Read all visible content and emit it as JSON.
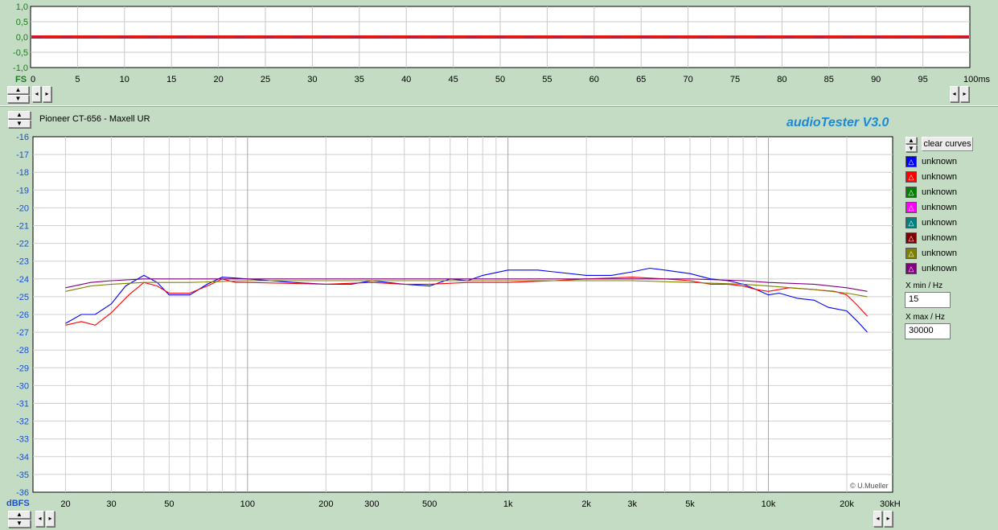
{
  "colors": {
    "background": "#c4dcc4",
    "accent": "#1a8ad4",
    "axis_text_blue": "#1a4fd0"
  },
  "app": {
    "brand": "audioTester  V3.0",
    "copyright": "© U.Mueller"
  },
  "scope": {
    "y_ticks": [
      "1,0",
      "0,5",
      "0,0",
      "-0,5",
      "-1,0"
    ],
    "x_ticks": [
      "0",
      "5",
      "10",
      "15",
      "20",
      "25",
      "30",
      "35",
      "40",
      "45",
      "50",
      "55",
      "60",
      "65",
      "70",
      "75",
      "80",
      "85",
      "90",
      "95",
      "100ms"
    ],
    "fs_label": "FS"
  },
  "graph": {
    "title": "Pioneer CT-656 - Maxell UR",
    "y_unit_label": "dBFS",
    "clear_label": "clear curves",
    "xmin_label": "X min / Hz",
    "xmin_value": "15",
    "xmax_label": "X max / Hz",
    "xmax_value": "30000"
  },
  "legend": [
    {
      "label": "unknown",
      "color": "#0000ff"
    },
    {
      "label": "unknown",
      "color": "#ff0000"
    },
    {
      "label": "unknown",
      "color": "#008000"
    },
    {
      "label": "unknown",
      "color": "#ff00ff"
    },
    {
      "label": "unknown",
      "color": "#008080"
    },
    {
      "label": "unknown",
      "color": "#800000"
    },
    {
      "label": "unknown",
      "color": "#808000"
    },
    {
      "label": "unknown",
      "color": "#800080"
    }
  ],
  "chart_data": {
    "type": "line",
    "x_scale": "log",
    "xlim": [
      15,
      30000
    ],
    "ylim": [
      -36,
      -16
    ],
    "grid": true,
    "y_ticks": [
      -16,
      -17,
      -18,
      -19,
      -20,
      -21,
      -22,
      -23,
      -24,
      -25,
      -26,
      -27,
      -28,
      -29,
      -30,
      -31,
      -32,
      -33,
      -34,
      -35,
      -36
    ],
    "x_tick_labels": [
      {
        "v": 20,
        "t": "20"
      },
      {
        "v": 30,
        "t": "30"
      },
      {
        "v": 50,
        "t": "50"
      },
      {
        "v": 100,
        "t": "100"
      },
      {
        "v": 200,
        "t": "200"
      },
      {
        "v": 300,
        "t": "300"
      },
      {
        "v": 500,
        "t": "500"
      },
      {
        "v": 1000,
        "t": "1k"
      },
      {
        "v": 2000,
        "t": "2k"
      },
      {
        "v": 3000,
        "t": "3k"
      },
      {
        "v": 5000,
        "t": "5k"
      },
      {
        "v": 10000,
        "t": "10k"
      },
      {
        "v": 20000,
        "t": "20k"
      },
      {
        "v": 30000,
        "t": "30kHz"
      }
    ],
    "series": [
      {
        "color": "#0000ff",
        "points": [
          [
            20,
            -26.5
          ],
          [
            23,
            -26
          ],
          [
            26,
            -26
          ],
          [
            30,
            -25.4
          ],
          [
            34,
            -24.4
          ],
          [
            40,
            -23.8
          ],
          [
            45,
            -24.2
          ],
          [
            50,
            -24.9
          ],
          [
            60,
            -24.9
          ],
          [
            70,
            -24.3
          ],
          [
            80,
            -23.9
          ],
          [
            100,
            -24
          ],
          [
            150,
            -24.2
          ],
          [
            200,
            -24.3
          ],
          [
            250,
            -24.3
          ],
          [
            300,
            -24.1
          ],
          [
            400,
            -24.3
          ],
          [
            500,
            -24.4
          ],
          [
            600,
            -24
          ],
          [
            700,
            -24.1
          ],
          [
            800,
            -23.8
          ],
          [
            1000,
            -23.5
          ],
          [
            1300,
            -23.5
          ],
          [
            1500,
            -23.6
          ],
          [
            2000,
            -23.8
          ],
          [
            2500,
            -23.8
          ],
          [
            3000,
            -23.6
          ],
          [
            3500,
            -23.4
          ],
          [
            4000,
            -23.5
          ],
          [
            5000,
            -23.7
          ],
          [
            6000,
            -24
          ],
          [
            7000,
            -24.1
          ],
          [
            8000,
            -24.3
          ],
          [
            9000,
            -24.6
          ],
          [
            10000,
            -24.9
          ],
          [
            11000,
            -24.8
          ],
          [
            13000,
            -25.1
          ],
          [
            15000,
            -25.2
          ],
          [
            17000,
            -25.6
          ],
          [
            20000,
            -25.8
          ],
          [
            22000,
            -26.4
          ],
          [
            24000,
            -27
          ]
        ]
      },
      {
        "color": "#ff0000",
        "points": [
          [
            20,
            -26.6
          ],
          [
            23,
            -26.4
          ],
          [
            26,
            -26.6
          ],
          [
            30,
            -25.9
          ],
          [
            35,
            -24.9
          ],
          [
            40,
            -24.2
          ],
          [
            45,
            -24.4
          ],
          [
            50,
            -24.8
          ],
          [
            60,
            -24.8
          ],
          [
            70,
            -24.4
          ],
          [
            80,
            -24
          ],
          [
            90,
            -24.2
          ],
          [
            100,
            -24.2
          ],
          [
            200,
            -24.3
          ],
          [
            300,
            -24.2
          ],
          [
            400,
            -24.3
          ],
          [
            500,
            -24.3
          ],
          [
            700,
            -24.2
          ],
          [
            1000,
            -24.2
          ],
          [
            1500,
            -24.1
          ],
          [
            2000,
            -24
          ],
          [
            3000,
            -23.9
          ],
          [
            4000,
            -24
          ],
          [
            5000,
            -24.1
          ],
          [
            6000,
            -24.3
          ],
          [
            7000,
            -24.3
          ],
          [
            8000,
            -24.4
          ],
          [
            9000,
            -24.6
          ],
          [
            10000,
            -24.7
          ],
          [
            12000,
            -24.5
          ],
          [
            15000,
            -24.6
          ],
          [
            18000,
            -24.7
          ],
          [
            20000,
            -24.9
          ],
          [
            22000,
            -25.5
          ],
          [
            24000,
            -26.1
          ]
        ]
      },
      {
        "color": "#808000",
        "points": [
          [
            20,
            -24.7
          ],
          [
            25,
            -24.4
          ],
          [
            30,
            -24.3
          ],
          [
            40,
            -24.2
          ],
          [
            60,
            -24.2
          ],
          [
            100,
            -24.1
          ],
          [
            200,
            -24.1
          ],
          [
            500,
            -24.1
          ],
          [
            1000,
            -24.1
          ],
          [
            2000,
            -24.1
          ],
          [
            3000,
            -24.1
          ],
          [
            5000,
            -24.2
          ],
          [
            8000,
            -24.3
          ],
          [
            10000,
            -24.4
          ],
          [
            15000,
            -24.6
          ],
          [
            20000,
            -24.8
          ],
          [
            24000,
            -25
          ]
        ]
      },
      {
        "color": "#800080",
        "points": [
          [
            20,
            -24.5
          ],
          [
            25,
            -24.2
          ],
          [
            30,
            -24.1
          ],
          [
            40,
            -24
          ],
          [
            100,
            -24
          ],
          [
            200,
            -24
          ],
          [
            500,
            -24
          ],
          [
            1000,
            -24
          ],
          [
            2000,
            -24
          ],
          [
            3000,
            -24
          ],
          [
            5000,
            -24
          ],
          [
            8000,
            -24.1
          ],
          [
            10000,
            -24.2
          ],
          [
            15000,
            -24.3
          ],
          [
            20000,
            -24.5
          ],
          [
            24000,
            -24.7
          ]
        ]
      }
    ]
  }
}
